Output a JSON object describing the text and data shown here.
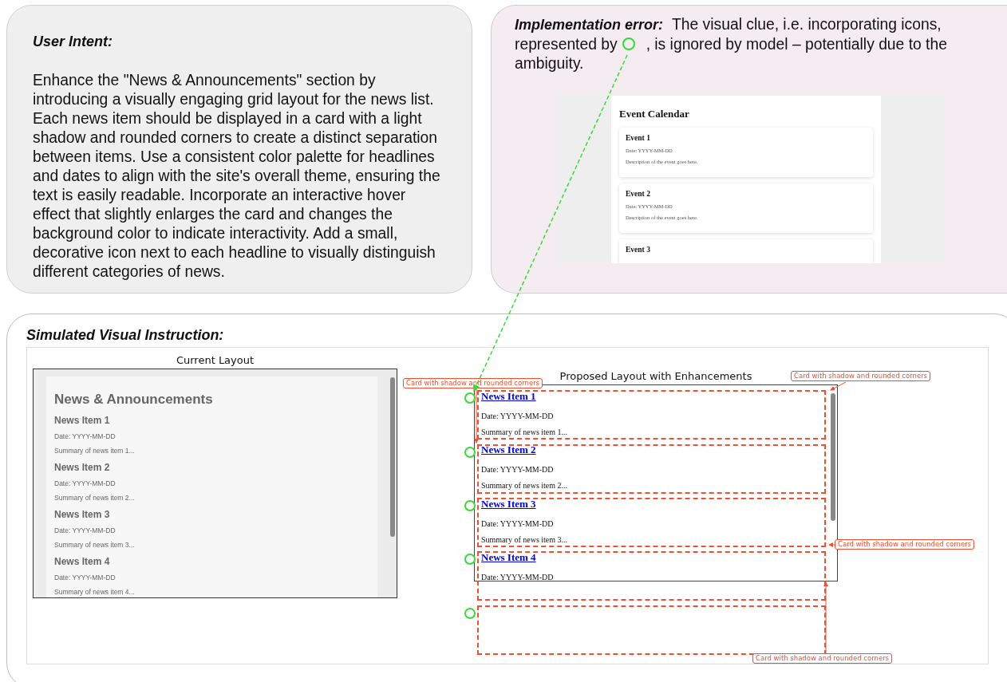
{
  "user_intent": {
    "title": "User Intent:",
    "text": "Enhance the \"News & Announcements\" section by introducing a visually engaging grid layout for the news list. Each news item should be displayed in a card with a light shadow and rounded corners to create a distinct separation between items. Use a consistent color palette for headlines and dates to align with the site's overall theme, ensuring the text is easily readable. Incorporate an interactive hover effect that slightly enlarges the card and changes the background color to indicate interactivity. Add a small, decorative icon next to each headline to visually distinguish different categories of news."
  },
  "implementation_error": {
    "title": "Implementation error:",
    "text_before": "The visual clue, i.e. incorporating icons, represented by",
    "text_after": ", is ignored by model – potentially due to the ambiguity.",
    "screenshot": {
      "heading": "Event Calendar",
      "events": [
        {
          "title": "Event 1",
          "date": "Date: YYYY-MM-DD",
          "description": "Description of the event goes here."
        },
        {
          "title": "Event 2",
          "date": "Date: YYYY-MM-DD",
          "description": "Description of the event goes here."
        },
        {
          "title": "Event 3"
        }
      ]
    }
  },
  "simulated": {
    "title": "Simulated Visual Instruction:",
    "current": {
      "caption": "Current Layout",
      "heading": "News & Announcements",
      "items": [
        {
          "title": "News Item 1",
          "date": "Date: YYYY-MM-DD",
          "summary": "Summary of news item 1..."
        },
        {
          "title": "News Item 2",
          "date": "Date: YYYY-MM-DD",
          "summary": "Summary of news item 2..."
        },
        {
          "title": "News Item 3",
          "date": "Date: YYYY-MM-DD",
          "summary": "Summary of news item 3..."
        },
        {
          "title": "News Item 4",
          "date": "Date: YYYY-MM-DD",
          "summary": "Summary of news item 4..."
        }
      ]
    },
    "proposed": {
      "caption": "Proposed Layout with Enhancements",
      "items": [
        {
          "title": "News Item 1",
          "date": "Date: YYYY-MM-DD",
          "summary": "Summary of news item 1..."
        },
        {
          "title": "News Item 2",
          "date": "Date: YYYY-MM-DD",
          "summary": "Summary of news item 2..."
        },
        {
          "title": "News Item 3",
          "date": "Date: YYYY-MM-DD",
          "summary": "Summary of news item 3..."
        },
        {
          "title": "News Item 4",
          "date": "Date: YYYY-MM-DD"
        }
      ]
    },
    "annotations": [
      "Card with shadow and rounded corners",
      "Card with shadow and rounded corners",
      "Card with shadow and rounded corners",
      "Card with shadow and rounded corners"
    ]
  }
}
